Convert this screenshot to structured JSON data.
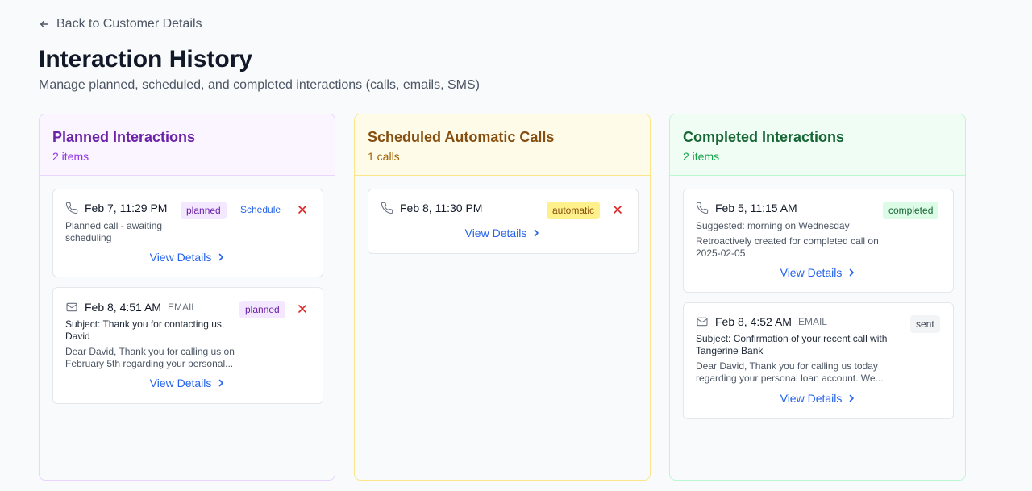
{
  "nav": {
    "back_label": "Back to Customer Details"
  },
  "header": {
    "title": "Interaction History",
    "subtitle": "Manage planned, scheduled, and completed interactions (calls, emails, SMS)"
  },
  "columns": {
    "planned": {
      "title": "Planned Interactions",
      "count": "2 items",
      "cards": [
        {
          "datetime": "Feb 7, 11:29 PM",
          "badge": "planned",
          "schedule_label": "Schedule",
          "description": "Planned call - awaiting scheduling",
          "view_label": "View Details"
        },
        {
          "datetime": "Feb 8, 4:51 AM",
          "type": "EMAIL",
          "badge": "planned",
          "subject": "Subject: Thank you for contacting us, David",
          "description": "Dear David, Thank you for calling us on February 5th regarding your personal...",
          "view_label": "View Details"
        }
      ]
    },
    "scheduled": {
      "title": "Scheduled Automatic Calls",
      "count": "1 calls",
      "cards": [
        {
          "datetime": "Feb 8, 11:30 PM",
          "badge": "automatic",
          "view_label": "View Details"
        }
      ]
    },
    "completed": {
      "title": "Completed Interactions",
      "count": "2 items",
      "cards": [
        {
          "datetime": "Feb 5, 11:15 AM",
          "badge": "completed",
          "suggested": "Suggested: morning on Wednesday",
          "description": "Retroactively created for completed call on 2025-02-05",
          "view_label": "View Details"
        },
        {
          "datetime": "Feb 8, 4:52 AM",
          "type": "EMAIL",
          "badge": "sent",
          "subject": "Subject: Confirmation of your recent call with Tangerine Bank",
          "description": "Dear David, Thank you for calling us today regarding your personal loan account. We...",
          "view_label": "View Details"
        }
      ]
    }
  },
  "colors": {
    "link": "#2563eb",
    "delete": "#dc2626"
  }
}
